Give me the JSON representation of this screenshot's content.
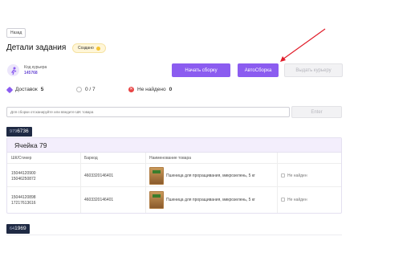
{
  "header": {
    "back_label": "Назад",
    "title": "Детали задания",
    "status": "Создано"
  },
  "courier": {
    "label": "Код курьера",
    "code": "145768"
  },
  "actions": {
    "start": "Начать сборку",
    "auto": "АвтоСборка",
    "hand_over": "Выдать курьеру"
  },
  "stats": {
    "delivered_label": "Доставок",
    "delivered_count": "5",
    "progress": "0 / 7",
    "not_found_label": "Не найдено",
    "not_found_count": "0"
  },
  "scan": {
    "placeholder": "Для сборки отсканируйте или введите ШК товара",
    "enter_label": "Enter"
  },
  "orders": [
    {
      "tag_prefix": "979",
      "tag_number": "6736",
      "cell": "Ячейка 79",
      "columns": [
        "ШК/Стикер",
        "Баркод",
        "Наименование товара",
        ""
      ],
      "rows": [
        {
          "sticker_1": "15044120900",
          "sticker_2": "15046250872",
          "barcode": "4603320146401",
          "name": "Пшеница для проращивания, микрозелень, 5 кг",
          "status": "Не найден"
        },
        {
          "sticker_1": "15044120898",
          "sticker_2": "17217613616",
          "barcode": "4603320146401",
          "name": "Пшеница для проращивания, микрозелень, 5 кг",
          "status": "Не найден"
        }
      ]
    },
    {
      "tag_prefix": "64",
      "tag_number": "1969"
    }
  ],
  "colors": {
    "accent": "#8b5cf0",
    "badge": "#fff6d8",
    "tag": "#1f2a44",
    "error": "#e84545"
  }
}
